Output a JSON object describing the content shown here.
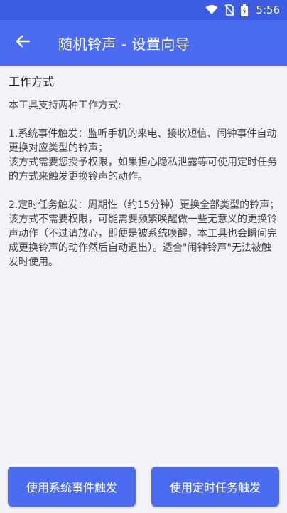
{
  "status_bar": {
    "time": "5:56",
    "icons": [
      "wifi-icon",
      "no-sim-icon",
      "battery-icon"
    ]
  },
  "app_bar": {
    "title": "随机铃声 - 设置向导",
    "back_icon": "arrow-left-icon"
  },
  "content": {
    "heading": "工作方式",
    "intro": "本工具支持两种工作方式:",
    "mode1": "1.系统事件触发：监听手机的来电、接收短信、闹钟事件自动更换对应类型的铃声；\n该方式需要您授予权限，如果担心隐私泄露等可使用定时任务的方式来触发更换铃声的动作。",
    "mode2": "2.定时任务触发：周期性（约15分钟）更换全部类型的铃声；\n该方式不需要权限，可能需要频繁唤醒做一些无意义的更换铃声动作（不过请放心，即便是被系统唤醒，本工具也会瞬间完成更换铃声的动作然后自动退出）。适合\"闹钟铃声\"无法被触发时使用。"
  },
  "buttons": {
    "system_event": "使用系统事件触发",
    "timer_task": "使用定时任务触发"
  },
  "colors": {
    "primary": "#4b6bf0",
    "status_bar": "#3c5ce4",
    "background": "#f3f3f7"
  }
}
